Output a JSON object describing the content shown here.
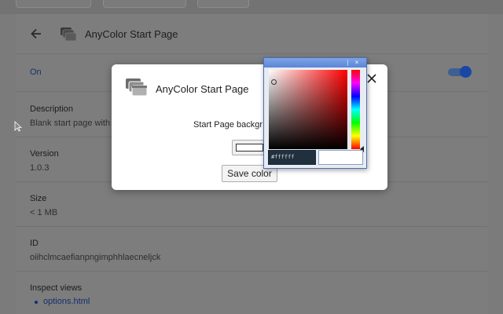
{
  "page": {
    "title": "AnyColor Start Page",
    "on_label": "On",
    "fields": [
      {
        "label": "Description",
        "value": "Blank start page with"
      },
      {
        "label": "Version",
        "value": "1.0.3"
      },
      {
        "label": "Size",
        "value": "< 1 MB"
      },
      {
        "label": "ID",
        "value": "oiihclmcaefianpngimphhlaecnelјck"
      }
    ],
    "inspect_views": {
      "label": "Inspect views",
      "link": "options.html"
    },
    "toggle_on": true
  },
  "dialog": {
    "title": "AnyColor Start Page",
    "label": "Start Page backgr",
    "save_label": "Save color",
    "selected_color": "#ffffff"
  },
  "picker": {
    "hex_value": "#ffffff",
    "close_glyph": "×",
    "hue_color": "#ff0000"
  },
  "colors": {
    "accent": "#1a47a5",
    "link": "#102f6e",
    "picker_titlebar": "#5b86d6"
  }
}
